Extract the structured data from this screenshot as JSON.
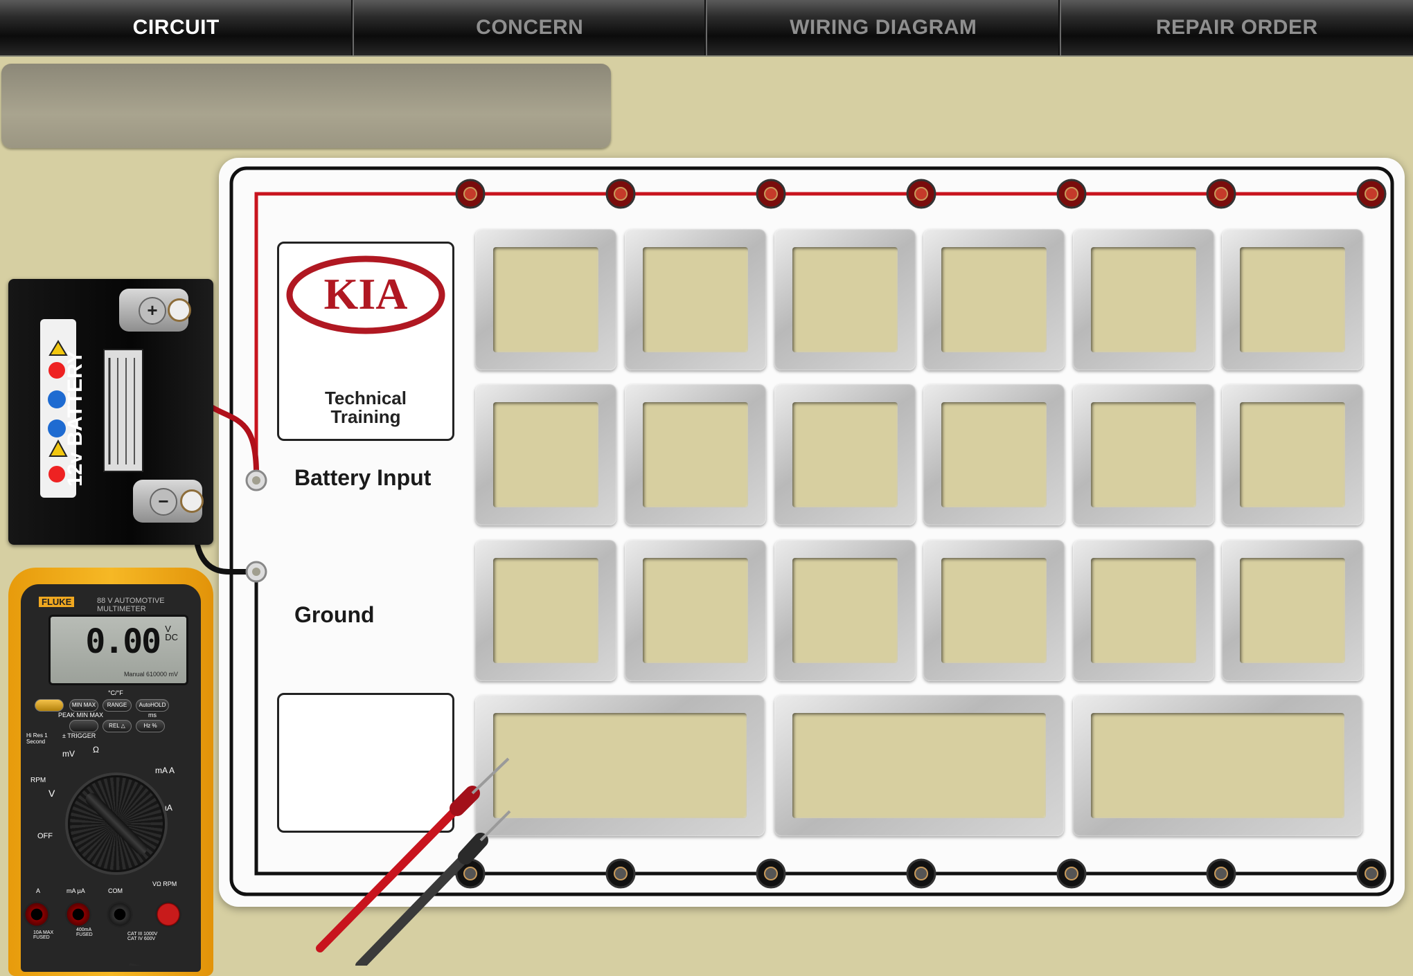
{
  "tabs": [
    {
      "label": "CIRCUIT",
      "active": true
    },
    {
      "label": "CONCERN",
      "active": false
    },
    {
      "label": "WIRING DIAGRAM",
      "active": false
    },
    {
      "label": "REPAIR ORDER",
      "active": false
    }
  ],
  "board": {
    "logo_text": "KIA",
    "logo_subtitle_line1": "Technical",
    "logo_subtitle_line2": "Training",
    "battery_input_label": "Battery Input",
    "ground_label": "Ground"
  },
  "battery": {
    "label": "12v BATTERY",
    "positive_symbol": "+",
    "negative_symbol": "−"
  },
  "multimeter": {
    "brand": "FLUKE",
    "model": "88 V AUTOMOTIVE MULTIMETER",
    "reading": "0.00",
    "unit_top": "V",
    "unit_bottom": "DC",
    "manual_text": "Manual 610000 mV",
    "buttons": {
      "minmax": "MIN MAX",
      "range": "RANGE",
      "autohold": "AutoHOLD",
      "peak": "PEAK MIN MAX",
      "rel": "REL △",
      "hz": "Hz %",
      "trigger": "± TRIGGER",
      "hires": "Hi Res 1 Second",
      "ms": "ms",
      "temp": "°C/°F"
    },
    "dial_labels": {
      "off": "OFF",
      "v": "V",
      "mv": "mV",
      "ohm": "Ω",
      "ma_a": "mA A",
      "ua": "µA",
      "rpm": "RPM"
    },
    "jacks": {
      "a": "A",
      "ma": "mA µA",
      "com": "COM",
      "v": "VΩ RPM",
      "a_note": "10A MAX FUSED",
      "ma_note": "400mA FUSED",
      "cat_note": "CAT III 1000V CAT IV 600V"
    }
  },
  "colors": {
    "background": "#d6cfa2",
    "wire_positive": "#c8141e",
    "wire_ground": "#111111",
    "meter_case": "#f6b825"
  }
}
